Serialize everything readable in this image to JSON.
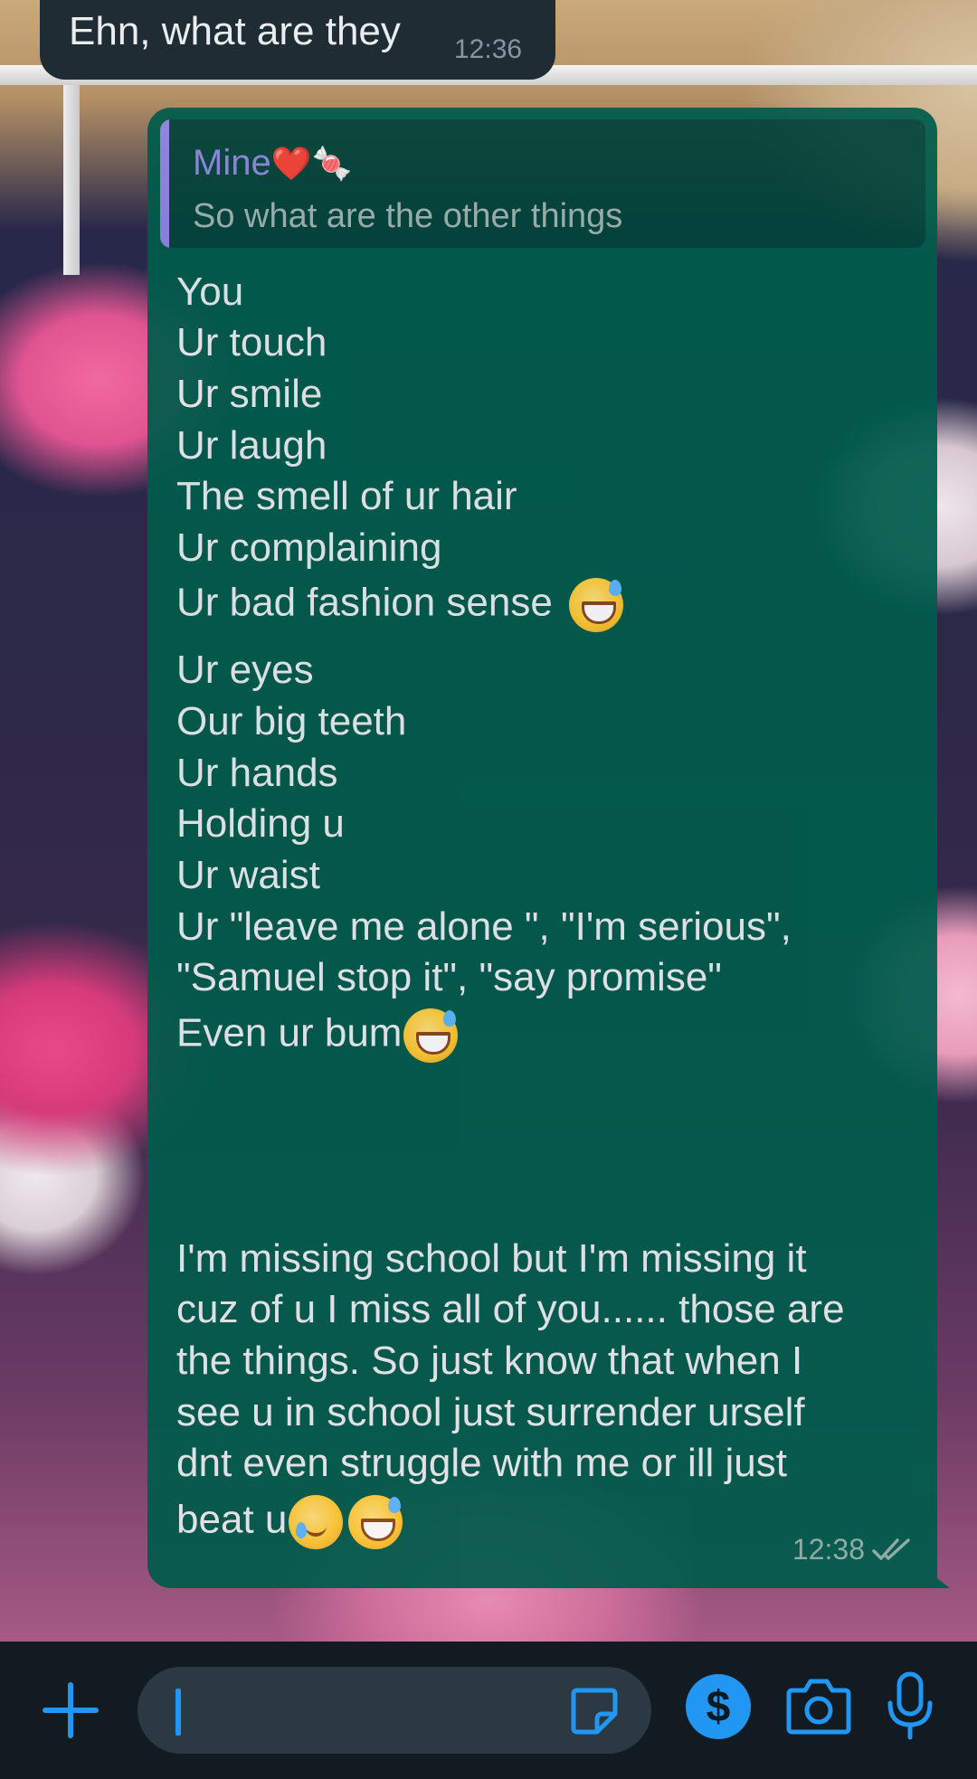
{
  "received": {
    "text": "Ehn, what are they",
    "time": "12:36"
  },
  "sent": {
    "quote": {
      "author": "Mine",
      "author_emoji": "❤️🍬",
      "text": "So what are the other things"
    },
    "lines": [
      "You",
      "Ur touch",
      "Ur smile",
      "Ur laugh",
      "The smell of ur hair",
      "Ur complaining",
      "Ur bad fashion sense ",
      "Ur eyes",
      "Our big teeth",
      "Ur hands",
      "Holding u",
      "Ur waist",
      "Ur \"leave me alone \", \"I'm serious\",",
      "\"Samuel stop it\",  \"say promise\"",
      "Even ur bum",
      "I'm missing school but I'm missing it",
      "cuz of u I miss all of you...... those are",
      "the things. So just know that when I",
      "see u in school just surrender urself",
      "dnt even struggle with me or ill just",
      "beat u"
    ],
    "time": "12:38",
    "status_icon": "double-check-icon"
  },
  "composer": {
    "icons": [
      "plus-icon",
      "sticker-icon",
      "payment-icon",
      "camera-icon",
      "mic-icon"
    ],
    "pay_symbol": "$"
  },
  "colors": {
    "sent_bubble": "#005c4b",
    "received_bubble": "#1f2c34",
    "accent": "#2196f3",
    "quote_author": "#8e88e0"
  }
}
